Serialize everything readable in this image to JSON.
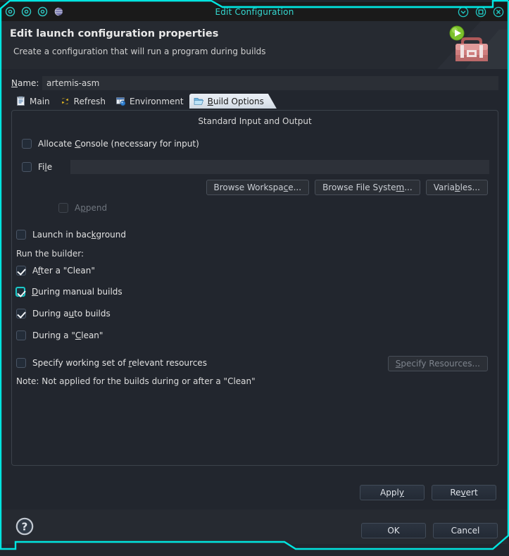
{
  "window": {
    "title": "Edit Configuration",
    "titlebar_left_icons": [
      "target-icon",
      "target-icon",
      "target-icon",
      "globe-icon"
    ],
    "titlebar_right_icons": [
      "minimize-icon",
      "maximize-icon",
      "close-icon"
    ],
    "accent_color": "#00e5e0",
    "titlebar_bg": "#1a1a1a",
    "body_bg": "#22262e"
  },
  "header": {
    "title": "Edit launch configuration properties",
    "subtitle": "Create a configuration that will run a program during builds",
    "art_icon": "toolbox-with-run-badge-icon"
  },
  "name_field": {
    "label": "Name:",
    "label_mnemonic": "N",
    "value": "artemis-asm",
    "placeholder": ""
  },
  "tabs": [
    {
      "label": "Main",
      "icon": "document-icon",
      "active": false,
      "mnemonic": ""
    },
    {
      "label": "Refresh",
      "icon": "refresh-arrows-icon",
      "active": false,
      "mnemonic": ""
    },
    {
      "label": "Environment",
      "icon": "environment-table-icon",
      "active": false,
      "mnemonic": ""
    },
    {
      "label": "Build Options",
      "icon": "open-folder-icon",
      "active": true,
      "mnemonic": "B"
    }
  ],
  "panel": {
    "group_title": "Standard Input and Output",
    "allocate_console": {
      "label_pre": "Allocate ",
      "label_mnemonic": "C",
      "label_post": "onsole (necessary for input)",
      "checked": false
    },
    "file": {
      "label_pre": "Fi",
      "label_mnemonic": "l",
      "label_post": "e",
      "checked": false,
      "value": "",
      "placeholder": ""
    },
    "buttons": [
      {
        "label_pre": "Browse Workspa",
        "label_mnemonic": "c",
        "label_post": "e...",
        "name": "browse-workspace-button"
      },
      {
        "label_pre": "Browse File Syste",
        "label_mnemonic": "m",
        "label_post": "...",
        "name": "browse-file-system-button"
      },
      {
        "label_pre": "Varia",
        "label_mnemonic": "b",
        "label_post": "les...",
        "name": "variables-button"
      }
    ],
    "append": {
      "label_pre": "A",
      "label_mnemonic": "p",
      "label_post": "pend",
      "checked": false,
      "disabled": true
    },
    "launch_in_background": {
      "label_pre": "Launch in bac",
      "label_mnemonic": "k",
      "label_post": "ground",
      "checked": false
    },
    "run_builder_label": "Run the builder:",
    "builder_options": [
      {
        "label_pre": "A",
        "label_mnemonic": "f",
        "label_post": "ter a \"Clean\"",
        "checked": true,
        "focused": false,
        "name": "checkbox-after-a-clean"
      },
      {
        "label_pre": "",
        "label_mnemonic": "D",
        "label_post": "uring manual builds",
        "checked": true,
        "focused": true,
        "name": "checkbox-during-manual-builds"
      },
      {
        "label_pre": "During a",
        "label_mnemonic": "u",
        "label_post": "to builds",
        "checked": true,
        "focused": false,
        "name": "checkbox-during-auto-builds"
      },
      {
        "label_pre": "During a \"",
        "label_mnemonic": "C",
        "label_post": "lean\"",
        "checked": false,
        "focused": false,
        "name": "checkbox-during-a-clean"
      }
    ],
    "specify_working_set": {
      "label_pre": "Specify working set of ",
      "label_mnemonic": "r",
      "label_post": "elevant resources",
      "checked": false
    },
    "specify_resources_button": {
      "label_pre": "",
      "label_mnemonic": "S",
      "label_post": "pecify Resources...",
      "disabled": true
    },
    "note": "Note: Not applied for the builds during or after a \"Clean\""
  },
  "action_buttons": {
    "apply": {
      "label_pre": "Appl",
      "label_mnemonic": "y",
      "label_post": ""
    },
    "revert": {
      "label_pre": "Re",
      "label_mnemonic": "v",
      "label_post": "ert"
    },
    "ok": {
      "label_pre": "OK",
      "label_mnemonic": "",
      "label_post": ""
    },
    "cancel": {
      "label_pre": "Cancel",
      "label_mnemonic": "",
      "label_post": ""
    }
  },
  "footer": {
    "help_icon": "help-question-icon"
  }
}
